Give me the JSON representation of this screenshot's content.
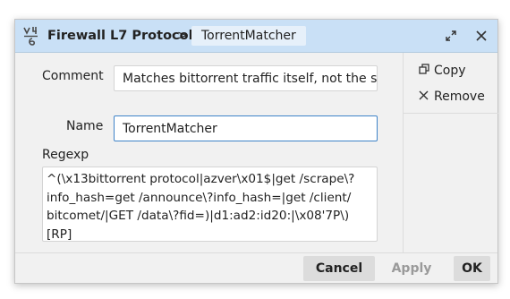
{
  "window": {
    "app_icon": "winbox-icon",
    "title": "Firewall L7 Protocol",
    "separator": ">",
    "item_name": "TorrentMatcher",
    "restore_icon": "restore-icon",
    "close_icon": "close-icon"
  },
  "side_panel": {
    "copy_label": "Copy",
    "copy_icon": "copy-icon",
    "remove_label": "Remove",
    "remove_icon": "remove-icon"
  },
  "form": {
    "comment_label": "Comment",
    "comment_value": "Matches bittorrent traffic itself, not the s",
    "name_label": "Name",
    "name_value": "TorrentMatcher",
    "regexp_label": "Regexp",
    "regexp_lines": [
      "^(\\x13bittorrent protocol|azver\\x01$|get /scrape\\?",
      "info_hash=get /announce\\?info_hash=|get /client/",
      "bitcomet/|GET /data\\?fid=)|d1:ad2:id20:|\\x08'7P\\)",
      "[RP]"
    ]
  },
  "footer": {
    "cancel_label": "Cancel",
    "apply_label": "Apply",
    "ok_label": "OK"
  },
  "colors": {
    "titlebar": "#c9e0f6",
    "focus_border": "#3e83c8",
    "disabled_text": "#9a9a9a"
  }
}
